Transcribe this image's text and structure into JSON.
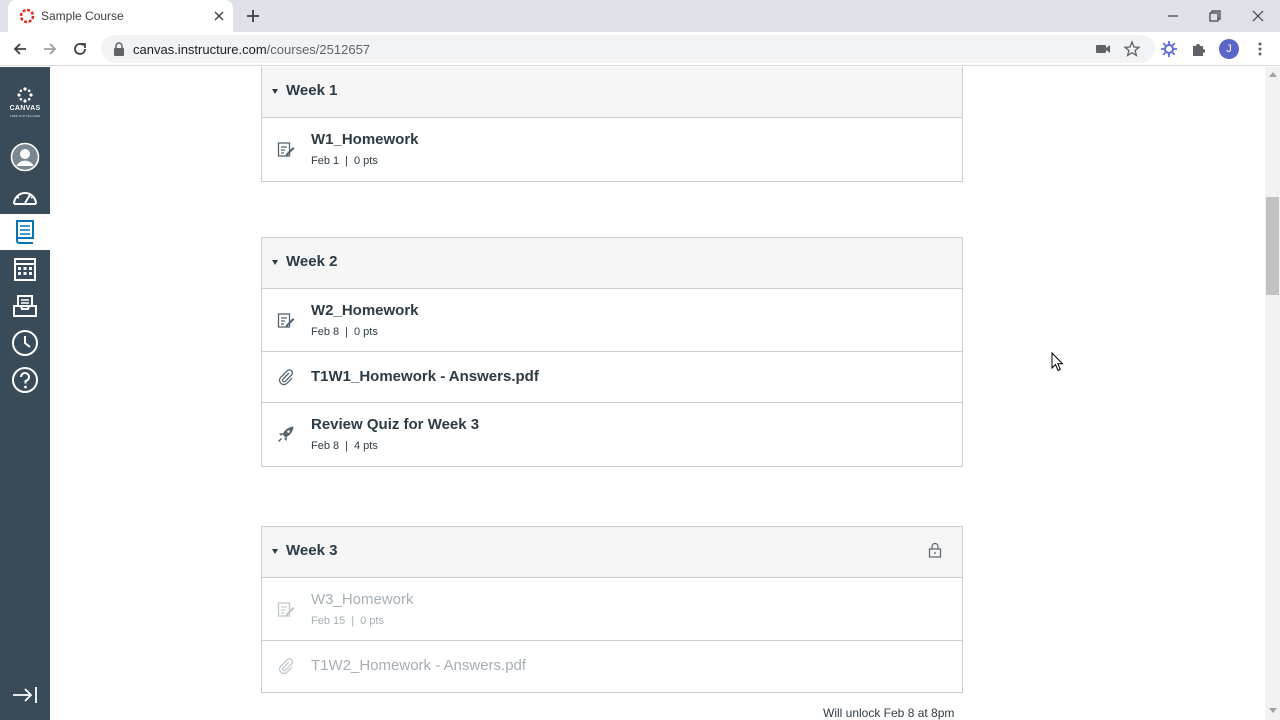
{
  "browser": {
    "tab_title": "Sample Course",
    "url_host": "canvas.instructure.com",
    "url_path": "/courses/2512657",
    "profile_initial": "J"
  },
  "sidebar": {
    "logo_text": "CANVAS",
    "logo_subtext": "FREE FOR TEACHER",
    "items": [
      {
        "icon": "account-icon"
      },
      {
        "icon": "dashboard-icon"
      },
      {
        "icon": "courses-icon",
        "active": true
      },
      {
        "icon": "calendar-icon"
      },
      {
        "icon": "inbox-icon"
      },
      {
        "icon": "history-icon"
      },
      {
        "icon": "help-icon"
      },
      {
        "icon": "collapse-icon"
      }
    ]
  },
  "modules": [
    {
      "title": "Week 1",
      "items": [
        {
          "type": "assignment-icon",
          "name": "W1_Homework",
          "date": "Feb 1",
          "points": "0 pts"
        }
      ]
    },
    {
      "title": "Week 2",
      "items": [
        {
          "type": "assignment-icon",
          "name": "W2_Homework",
          "date": "Feb 8",
          "points": "0 pts"
        },
        {
          "type": "attachment-icon",
          "name": "T1W1_Homework - Answers.pdf"
        },
        {
          "type": "quiz-icon",
          "name": "Review Quiz for Week 3",
          "date": "Feb 8",
          "points": "4 pts"
        }
      ]
    },
    {
      "title": "Week 3",
      "locked": true,
      "items": [
        {
          "type": "assignment-icon",
          "name": "W3_Homework",
          "date": "Feb 15",
          "points": "0 pts"
        },
        {
          "type": "attachment-icon",
          "name": "T1W2_Homework - Answers.pdf"
        }
      ],
      "unlock_text": "Will unlock Feb 8 at 8pm"
    }
  ],
  "colors": {
    "sidebar_bg": "#394b58",
    "active_icon": "#0374b5",
    "text": "#2d3b45",
    "muted_text": "#a5afb5",
    "border": "#c7cdd1",
    "header_bg": "#f5f5f5"
  }
}
